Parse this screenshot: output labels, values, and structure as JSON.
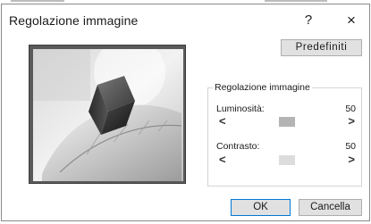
{
  "dialog": {
    "title": "Regolazione immagine",
    "help_glyph": "?",
    "close_glyph": "×"
  },
  "buttons": {
    "defaults": "Predefiniti",
    "ok": "OK",
    "cancel": "Cancella"
  },
  "preview": {
    "icon": "image-preview"
  },
  "adjust_group": {
    "label": "Regolazione immagine",
    "brightness": {
      "label": "Luminosità:",
      "value": "50",
      "left_arrow": "<",
      "right_arrow": ">"
    },
    "contrast": {
      "label": "Contrasto:",
      "value": "50",
      "left_arrow": "<",
      "right_arrow": ">"
    }
  },
  "colors": {
    "brightness_thumb": "#b4b4b4",
    "contrast_thumb": "#dcdcdc",
    "ok_border": "#0078d7"
  }
}
